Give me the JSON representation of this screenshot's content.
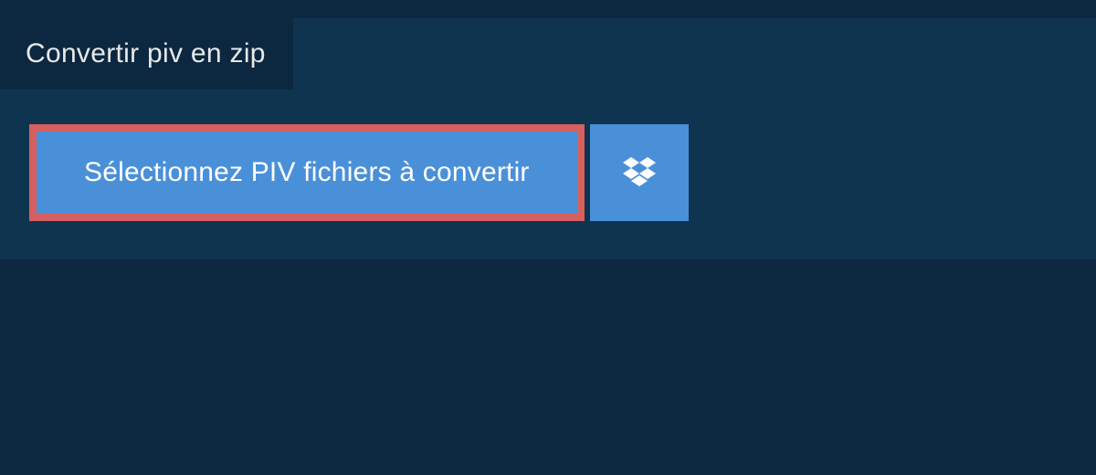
{
  "colors": {
    "page_bg": "#0c2840",
    "panel_bg": "#0f3450",
    "button_bg": "#4a90d9",
    "button_border": "#d66060",
    "text_light": "#e8e8e8",
    "text_white": "#ffffff"
  },
  "tab": {
    "label": "Convertir piv en zip"
  },
  "buttons": {
    "select_label": "Sélectionnez PIV fichiers à convertir",
    "dropbox_icon_name": "dropbox-icon"
  }
}
